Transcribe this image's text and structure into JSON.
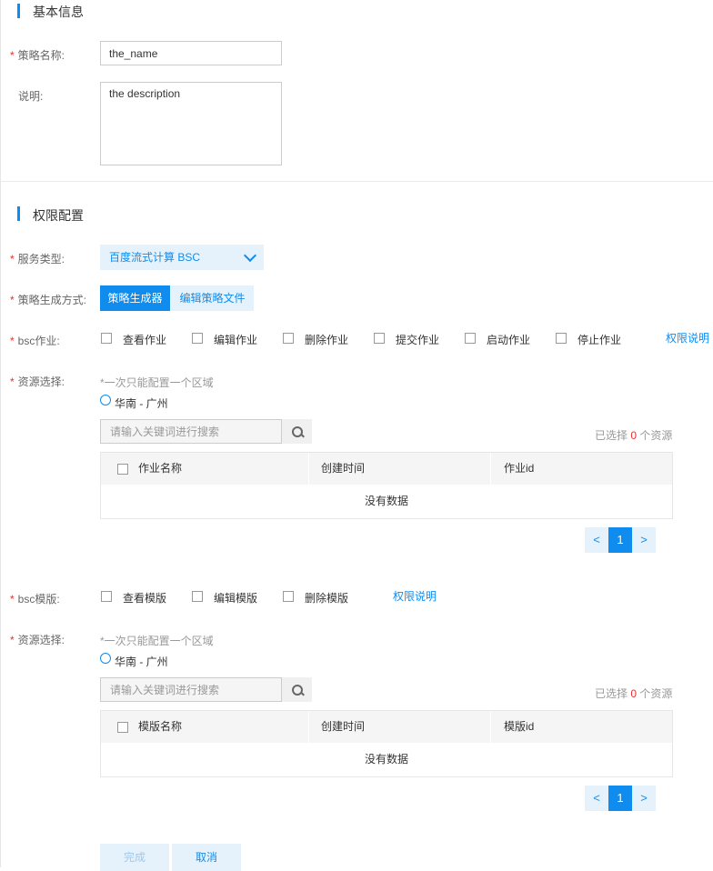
{
  "sections": {
    "basic": {
      "title": "基本信息"
    },
    "permission": {
      "title": "权限配置"
    }
  },
  "form": {
    "policy_name": {
      "label": "策略名称:",
      "value": "the_name",
      "required": true
    },
    "description": {
      "label": "说明:",
      "value": "the description",
      "required": false
    },
    "service_type": {
      "label": "服务类型:",
      "value": "百度流式计算 BSC",
      "required": true
    },
    "gen_mode": {
      "label": "策略生成方式:",
      "options": [
        "策略生成器",
        "编辑策略文件"
      ],
      "selected": "策略生成器",
      "required": true
    }
  },
  "bsc_job": {
    "label": "bsc作业:",
    "checkboxes": [
      "查看作业",
      "编辑作业",
      "删除作业",
      "提交作业",
      "启动作业",
      "停止作业"
    ],
    "help_link": "权限说明",
    "resource": {
      "label": "资源选择:",
      "hint": "*一次只能配置一个区域",
      "region": "华南 - 广州",
      "search_placeholder": "请输入关键词进行搜索",
      "selected_prefix": "已选择",
      "selected_count": "0",
      "selected_suffix": "个资源",
      "columns": [
        "作业名称",
        "创建时间",
        "作业id"
      ],
      "empty_text": "没有数据",
      "pager": {
        "prev": "<",
        "current": "1",
        "next": ">"
      }
    }
  },
  "bsc_template": {
    "label": "bsc模版:",
    "checkboxes": [
      "查看模版",
      "编辑模版",
      "删除模版"
    ],
    "help_link": "权限说明",
    "resource": {
      "label": "资源选择:",
      "hint": "*一次只能配置一个区域",
      "region": "华南 - 广州",
      "search_placeholder": "请输入关键词进行搜索",
      "selected_prefix": "已选择",
      "selected_count": "0",
      "selected_suffix": "个资源",
      "columns": [
        "模版名称",
        "创建时间",
        "模版id"
      ],
      "empty_text": "没有数据",
      "pager": {
        "prev": "<",
        "current": "1",
        "next": ">"
      }
    }
  },
  "footer": {
    "done_label": "完成",
    "cancel_label": "取消"
  },
  "colors": {
    "accent": "#108cee",
    "accent_light": "#e6f2fb",
    "required": "#ea2e2e"
  },
  "icons": {
    "search": "search-icon",
    "dropdown": "chevron-down-icon"
  }
}
